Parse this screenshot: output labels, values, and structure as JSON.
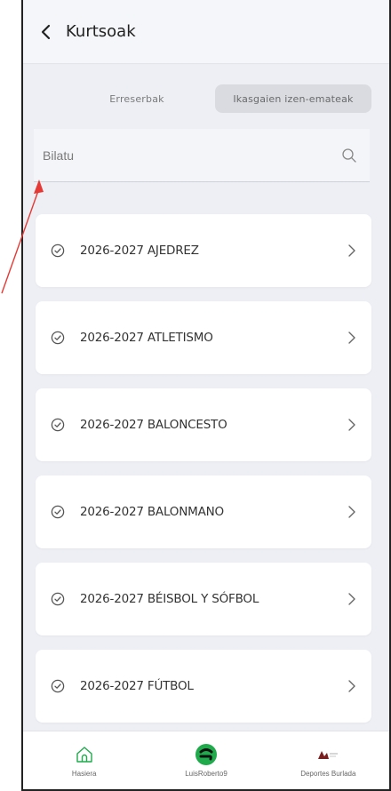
{
  "header": {
    "title": "Kurtsoak"
  },
  "segments": [
    {
      "label": "Erreserbak",
      "active": false
    },
    {
      "label": "Ikasgaien izen-emateak",
      "active": true
    }
  ],
  "search": {
    "placeholder": "Bilatu",
    "value": ""
  },
  "courses": [
    {
      "label": "2026-2027 AJEDREZ"
    },
    {
      "label": "2026-2027 ATLETISMO"
    },
    {
      "label": "2026-2027 BALONCESTO"
    },
    {
      "label": "2026-2027 BALONMANO"
    },
    {
      "label": "2026-2027 BÉISBOL Y SÓFBOL"
    },
    {
      "label": "2026-2027 FÚTBOL"
    }
  ],
  "tabbar": {
    "home": "Hasiera",
    "user": "LuisRoberto9",
    "club": "Deportes Burlada"
  },
  "colors": {
    "accent_green": "#1faa4b",
    "annotation_arrow": "#e53935"
  }
}
